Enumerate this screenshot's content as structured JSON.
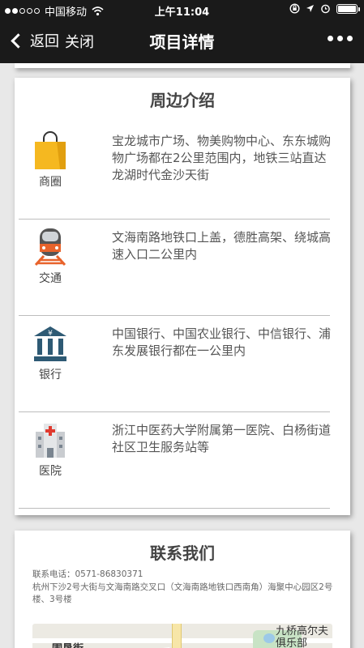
{
  "status_bar": {
    "carrier": "中国移动",
    "time": "上午11:04"
  },
  "nav": {
    "back_label": "返回",
    "close_label": "关闭",
    "title": "项目详情",
    "more_icon": "more-dots-icon"
  },
  "surroundings": {
    "title": "周边介绍",
    "items": [
      {
        "icon": "shopping-bag-icon",
        "label": "商圈",
        "text": "宝龙城市广场、物美购物中心、东东城购物广场都在2公里范围内，地铁三站直达龙湖时代金沙天街"
      },
      {
        "icon": "train-icon",
        "label": "交通",
        "text": "文海南路地铁口上盖，德胜高架、绕城高速入口二公里内"
      },
      {
        "icon": "bank-icon",
        "label": "银行",
        "text": "中国银行、中国农业银行、中信银行、浦东发展银行都在一公里内"
      },
      {
        "icon": "hospital-icon",
        "label": "医院",
        "text": "浙江中医药大学附属第一医院、白杨街道社区卫生服务站等"
      }
    ]
  },
  "contact": {
    "title": "联系我们",
    "phone": "联系电话：0571-86830371",
    "address": "杭州下沙2号大街与文海南路交叉口（文海南路地铁口西南角）海聚中心园区2号楼、3号楼",
    "map_labels": [
      "围垦街",
      "九桥高尔夫俱乐部"
    ]
  },
  "colors": {
    "nav_bg": "#1a1a1a",
    "page_bg": "#e8e8e8",
    "bag": "#f5b820",
    "train": "#e8632b",
    "bank": "#2e5a74",
    "hospital_cross": "#e03a2f"
  }
}
